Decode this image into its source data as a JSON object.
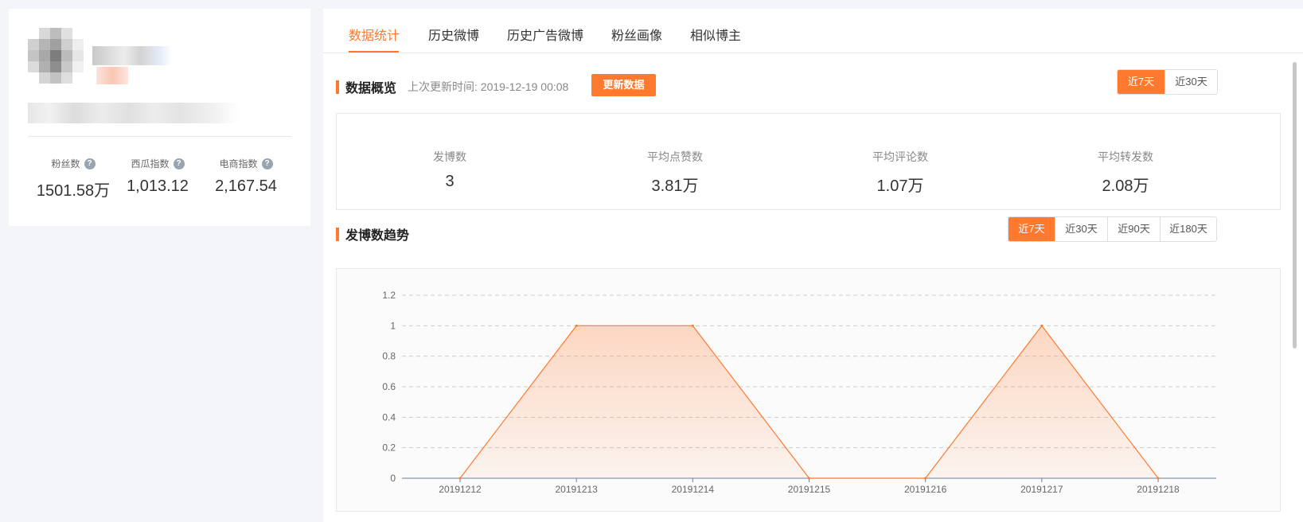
{
  "profile": {
    "metrics": [
      {
        "label": "粉丝数",
        "value": "1501.58万"
      },
      {
        "label": "西瓜指数",
        "value": "1,013.12"
      },
      {
        "label": "电商指数",
        "value": "2,167.54"
      }
    ],
    "help_glyph": "?"
  },
  "tabs": [
    {
      "label": "数据统计",
      "active": true
    },
    {
      "label": "历史微博",
      "active": false
    },
    {
      "label": "历史广告微博",
      "active": false
    },
    {
      "label": "粉丝画像",
      "active": false
    },
    {
      "label": "相似博主",
      "active": false
    }
  ],
  "overview": {
    "title": "数据概览",
    "updated_text": "上次更新时间: 2019-12-19 00:08",
    "update_button": "更新数据",
    "range_options": [
      {
        "label": "近7天",
        "active": true
      },
      {
        "label": "近30天",
        "active": false
      }
    ],
    "stats": [
      {
        "label": "发博数",
        "value": "3"
      },
      {
        "label": "平均点赞数",
        "value": "3.81万"
      },
      {
        "label": "平均评论数",
        "value": "1.07万"
      },
      {
        "label": "平均转发数",
        "value": "2.08万"
      }
    ]
  },
  "trend": {
    "title": "发博数趋势",
    "range_options": [
      {
        "label": "近7天",
        "active": true
      },
      {
        "label": "近30天",
        "active": false
      },
      {
        "label": "近90天",
        "active": false
      },
      {
        "label": "近180天",
        "active": false
      }
    ]
  },
  "colors": {
    "accent": "#ff7a2f",
    "axis": "#6e7f99",
    "grid": "#cccccc"
  },
  "chart_data": {
    "type": "area",
    "x": [
      "20191212",
      "20191213",
      "20191214",
      "20191215",
      "20191216",
      "20191217",
      "20191218"
    ],
    "series": [
      {
        "values": [
          0,
          1,
          1,
          0,
          0,
          1,
          0
        ]
      }
    ],
    "yticks": [
      "0",
      "0.2",
      "0.4",
      "0.6",
      "0.8",
      "1",
      "1.2"
    ],
    "ylim": [
      0,
      1.2
    ],
    "grid": true
  }
}
